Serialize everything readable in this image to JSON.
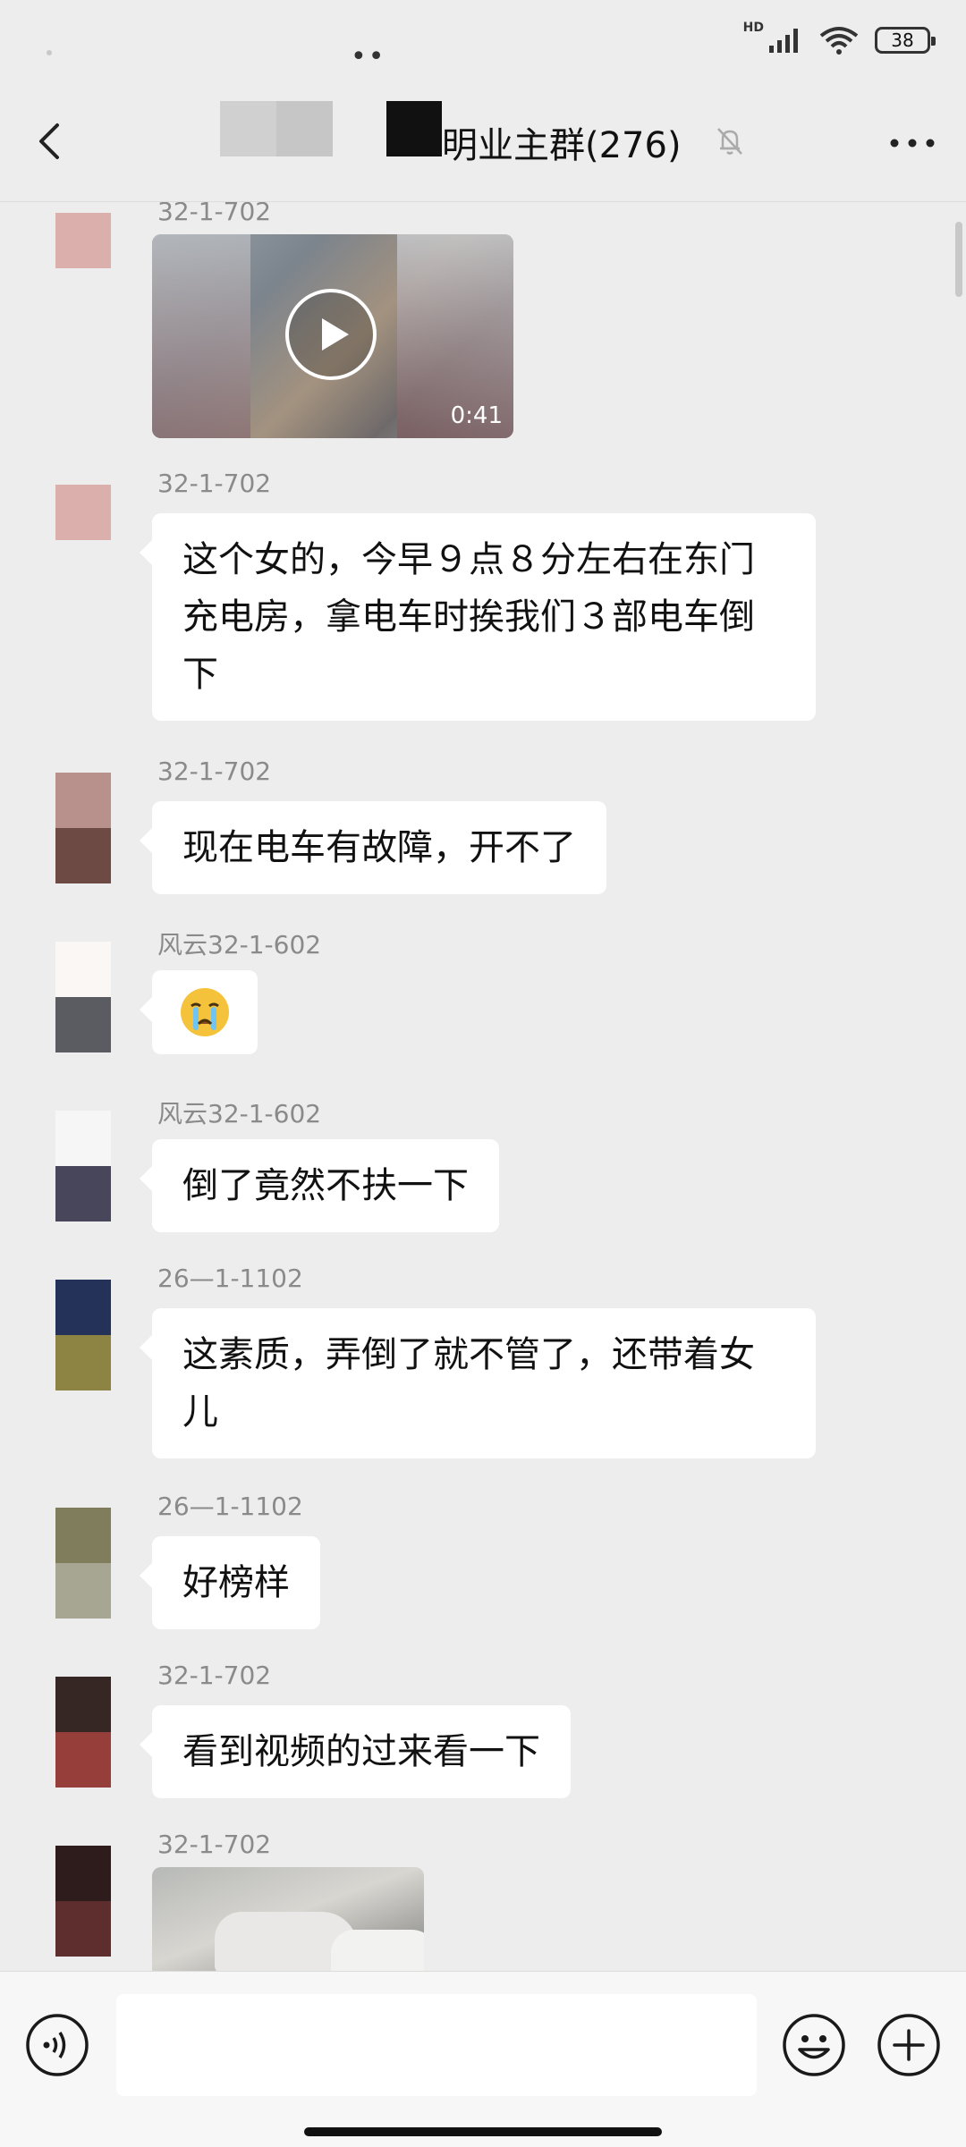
{
  "status_bar": {
    "hd": "HD",
    "battery": "38"
  },
  "nav": {
    "title": "明业主群(276)"
  },
  "messages": [
    {
      "sender": "32-1-702",
      "type": "video",
      "duration": "0:41",
      "avatar": [
        "#dbb0ac",
        "#dbb0ac"
      ]
    },
    {
      "sender": "32-1-702",
      "type": "text",
      "text": "这个女的，今早９点８分左右在东门充电房，拿电车时挨我们３部电车倒下",
      "avatar": [
        "#dbb0ac",
        "#dbb0ac"
      ]
    },
    {
      "sender": "32-1-702",
      "type": "text",
      "text": "现在电车有故障，开不了",
      "avatar": [
        "#b8908c",
        "#6e4a44"
      ]
    },
    {
      "sender": "风云32-1-602",
      "type": "emoji",
      "emoji": "crying-face",
      "avatar": [
        "#faf7f4",
        "#5a5c62"
      ]
    },
    {
      "sender": "风云32-1-602",
      "type": "text",
      "text": "倒了竟然不扶一下",
      "avatar": [
        "#f6f6f6",
        "#47465a"
      ]
    },
    {
      "sender": "26—1-1102",
      "type": "text",
      "text": "这素质，弄倒了就不管了，还带着女儿",
      "avatar": [
        "#24325a",
        "#8d8444"
      ]
    },
    {
      "sender": "26—1-1102",
      "type": "text",
      "text": "好榜样",
      "avatar": [
        "#7f7d5c",
        "#a7a692"
      ]
    },
    {
      "sender": "32-1-702",
      "type": "text",
      "text": "看到视频的过来看一下",
      "avatar": [
        "#362624",
        "#953e3a"
      ]
    },
    {
      "sender": "32-1-702",
      "type": "image",
      "avatar": [
        "#2e1c1c",
        "#5e2e2f"
      ]
    }
  ],
  "colors": {
    "background": "#ededed",
    "bubble": "#ffffff",
    "sender": "#8a8a8a"
  }
}
